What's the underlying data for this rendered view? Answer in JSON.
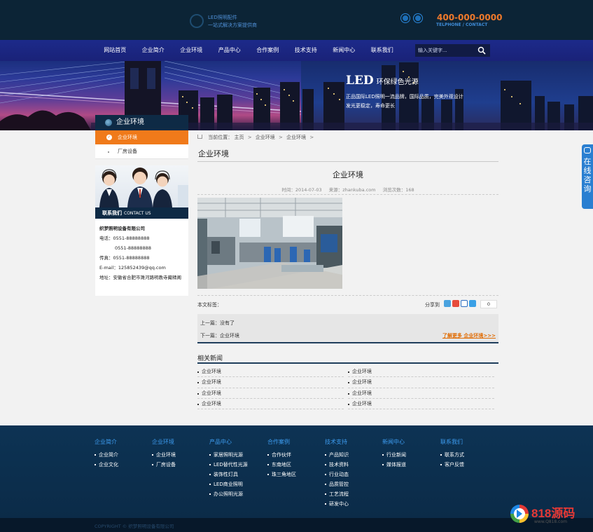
{
  "header": {
    "logo_line1": "LED照明配件",
    "logo_line2": "一站式解决方案提供商",
    "phone": "400-000-0000",
    "phone_sub": "TELPHONE / CONTACT"
  },
  "nav": {
    "items": [
      "网站首页",
      "企业简介",
      "企业环境",
      "产品中心",
      "合作案例",
      "技术支持",
      "新闻中心",
      "联系我们"
    ],
    "search_placeholder": "输入关键字..."
  },
  "banner": {
    "title": "LED",
    "title_suffix": "环保绿色光源",
    "line1": "正品国际LED照明一流品牌，国际品质，完美外观设计",
    "line2": "发光更稳定，寿命更长"
  },
  "sidebar": {
    "title": "企业环境",
    "items": [
      {
        "label": "企业环境",
        "active": true
      },
      {
        "label": "厂房设备",
        "active": false
      }
    ],
    "contact_title": "联系我们",
    "contact_title_en": "CONTACT US",
    "company": "织梦照明设备有限公司",
    "tel_label": "电话：",
    "tel1": "0551-88888888",
    "tel2": "0551-88888888",
    "fax_label": "传真：",
    "fax": "0551-88888888",
    "email_label": "E-mail：",
    "email": "125852439@qq.com",
    "addr_label": "地址：",
    "addr": "安徽省合肥市濉河路明教寺藏精阁"
  },
  "breadcrumb": {
    "prefix": "当前位置：",
    "items": [
      "主页",
      "企业环境",
      "企业环境"
    ]
  },
  "main": {
    "heading": "企业环境",
    "article_title": "企业环境",
    "meta_time": "时间：2014-07-03",
    "meta_source": "来源：zhankuba.com",
    "meta_views": "浏览次数：168",
    "tags_label": "本文标签：",
    "share_label": "分享到",
    "share_count": "0",
    "prev": "上一篇：没有了",
    "next": "下一篇：企业环境",
    "more": "了解更多 企业环境>>>"
  },
  "related": {
    "title": "相关新闻",
    "items": [
      "企业环境",
      "企业环境",
      "企业环境",
      "企业环境",
      "企业环境",
      "企业环境",
      "企业环境",
      "企业环境"
    ]
  },
  "consult": {
    "label": "在线咨询"
  },
  "footer": {
    "columns": [
      {
        "title": "企业简介",
        "items": [
          "企业简介",
          "企业文化"
        ]
      },
      {
        "title": "企业环境",
        "items": [
          "企业环境",
          "厂房设备"
        ]
      },
      {
        "title": "产品中心",
        "items": [
          "家居照明光源",
          "LED替代性光源",
          "装饰性灯具",
          "LED商业照明",
          "办公照明光源"
        ]
      },
      {
        "title": "合作案例",
        "items": [
          "合作伙伴",
          "东南地区",
          "珠三角地区"
        ]
      },
      {
        "title": "技术支持",
        "items": [
          "产品知识",
          "技术资料",
          "行业动态",
          "品质管控",
          "工艺流程",
          "研发中心"
        ]
      },
      {
        "title": "新闻中心",
        "items": [
          "行业新闻",
          "媒体报道"
        ]
      },
      {
        "title": "联系我们",
        "items": [
          "联系方式",
          "客户反馈"
        ]
      }
    ],
    "copyright": "COPYRIGHT © 织梦照明设备有限公司"
  },
  "watermark": {
    "brand": "818源码",
    "url": "www.Q818.com"
  },
  "colors": {
    "nav_bg": "#1c2a8a",
    "accent_orange": "#f07a1a",
    "dark_navy": "#0e2a45",
    "footer_bg": "#0d3354",
    "footer_link": "#3d9cf0"
  }
}
